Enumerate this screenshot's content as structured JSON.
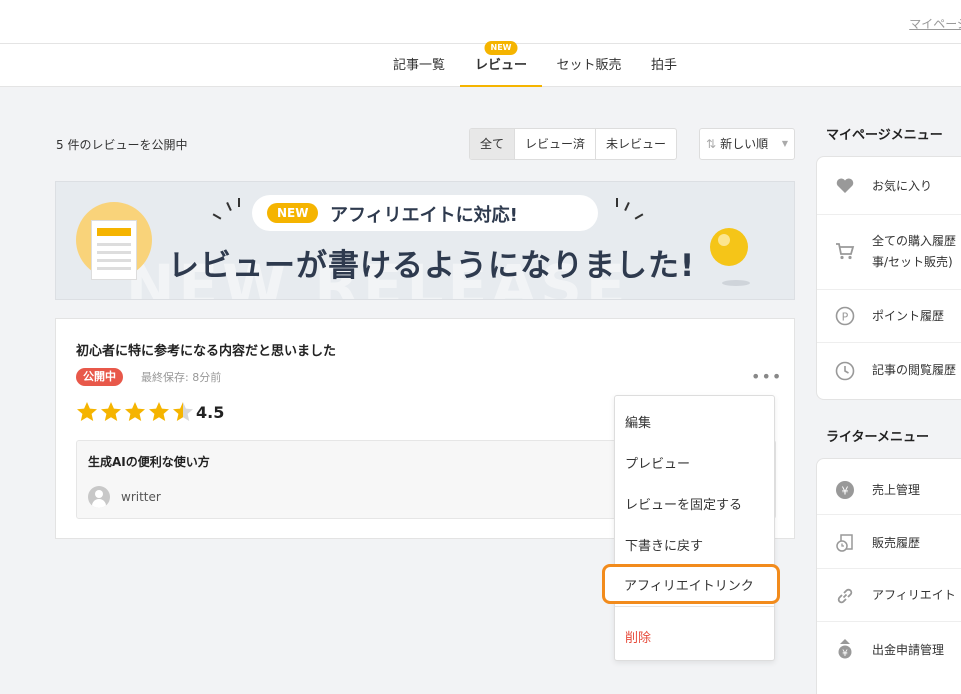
{
  "header": {
    "mypage_link": "マイページ"
  },
  "tabs": [
    {
      "label": "記事一覧"
    },
    {
      "label": "レビュー",
      "badge": "NEW",
      "active": true
    },
    {
      "label": "セット販売"
    },
    {
      "label": "拍手"
    }
  ],
  "main": {
    "count_text": "5 件のレビューを公開中",
    "filters": [
      "全て",
      "レビュー済",
      "未レビュー"
    ],
    "active_filter": "全て",
    "sort_label": "新しい順"
  },
  "banner": {
    "badge": "NEW",
    "subtitle": "アフィリエイトに対応!",
    "title": "レビューが書けるようになりました!",
    "background_text": "NEW RELEASE"
  },
  "review": {
    "title": "初心者に特に参考になる内容だと思いました",
    "status": "公開中",
    "saved": "最終保存: 8分前",
    "rating": "4.5",
    "rating_value": 4.5,
    "article_title": "生成AIの便利な使い方",
    "author": "writter"
  },
  "menu": {
    "items": [
      "編集",
      "プレビュー",
      "レビューを固定する",
      "下書きに戻す",
      "アフィリエイトリンク"
    ],
    "delete_label": "削除",
    "highlighted": "アフィリエイトリンク"
  },
  "sidebar": {
    "mypage_heading": "マイページメニュー",
    "mypage_items": [
      {
        "label": "お気に入り",
        "icon": "heart-icon"
      },
      {
        "label": "全ての購入履歴",
        "label2": "事/セット販売)",
        "icon": "cart-icon"
      },
      {
        "label": "ポイント履歴",
        "icon": "point-icon"
      },
      {
        "label": "記事の閲覧履歴",
        "icon": "clock-icon"
      }
    ],
    "writer_heading": "ライターメニュー",
    "writer_items": [
      {
        "label": "売上管理",
        "icon": "yen-icon"
      },
      {
        "label": "販売履歴",
        "icon": "history-icon"
      },
      {
        "label": "アフィリエイト",
        "icon": "link-icon"
      },
      {
        "label": "出金申請管理",
        "icon": "withdraw-icon"
      }
    ]
  },
  "colors": {
    "accent": "#f5b400",
    "danger": "#e8584a",
    "highlight": "#f28b1c"
  }
}
